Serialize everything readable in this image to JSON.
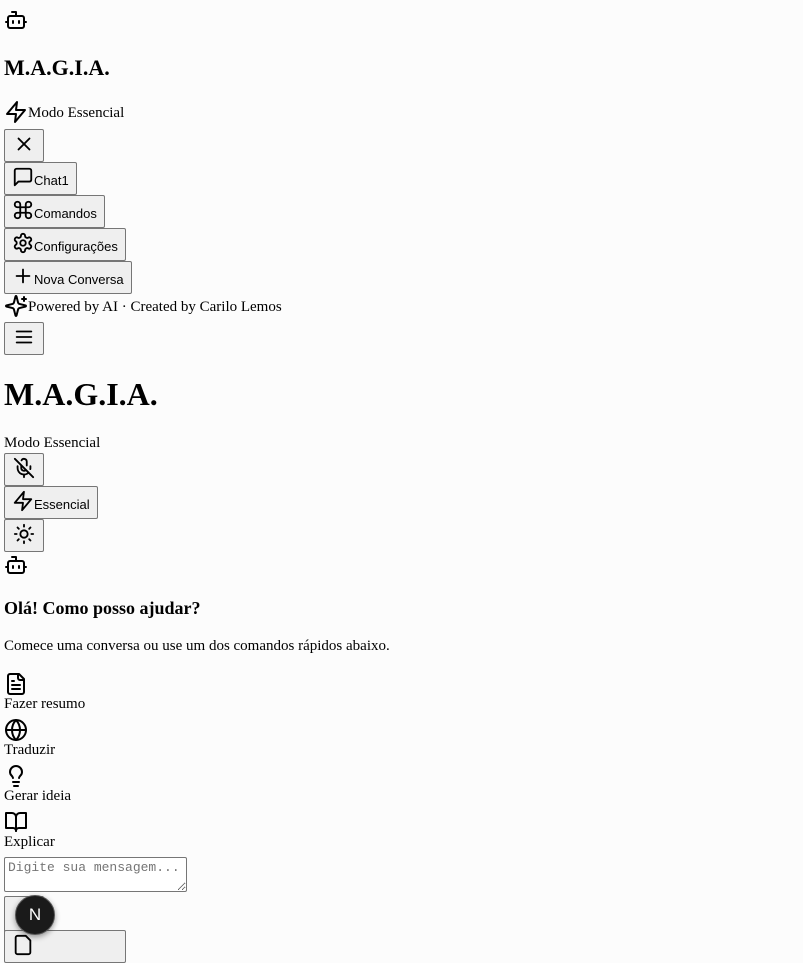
{
  "sidebar": {
    "brand": "M.A.G.I.A.",
    "mode_label": "Modo Essencial",
    "nav": [
      {
        "label": "Chat1"
      },
      {
        "label": "Comandos"
      },
      {
        "label": "Configurações"
      },
      {
        "label": "Nova Conversa"
      }
    ],
    "footer": "Powered by AI · Created by Carilo Lemos"
  },
  "header": {
    "title": "M.A.G.I.A.",
    "subtitle": "Modo Essencial",
    "mode_button": "Essencial"
  },
  "welcome": {
    "heading": "Olá! Como posso ajudar?",
    "text": "Comece uma conversa ou use um dos comandos rápidos abaixo.",
    "quick_commands": [
      {
        "label": "Fazer resumo",
        "icon": "file-text-icon"
      },
      {
        "label": "Traduzir",
        "icon": "globe-icon"
      },
      {
        "label": "Gerar ideia",
        "icon": "lightbulb-icon"
      },
      {
        "label": "Explicar",
        "icon": "book-open-icon"
      }
    ]
  },
  "composer": {
    "placeholder": "Digite sua mensagem..."
  },
  "badge": {
    "letter": "N"
  }
}
